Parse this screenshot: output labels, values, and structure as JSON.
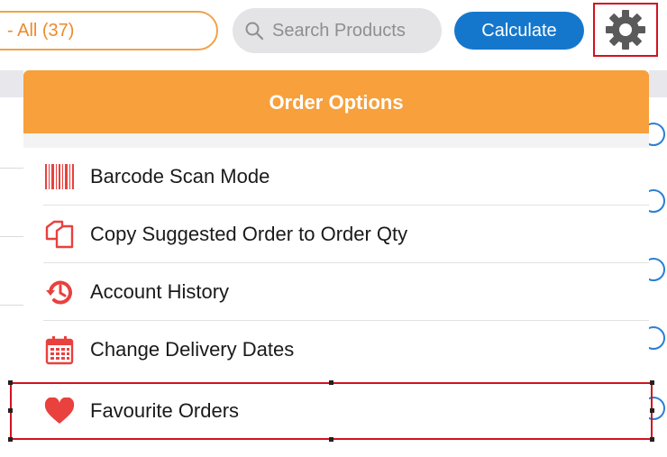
{
  "toolbar": {
    "filter_label": "- All (37)",
    "search_placeholder": "Search Products",
    "calculate_label": "Calculate"
  },
  "popover": {
    "title": "Order Options",
    "items": [
      {
        "label": "Barcode Scan Mode",
        "icon": "barcode-icon"
      },
      {
        "label": "Copy Suggested Order to Order Qty",
        "icon": "copy-icon"
      },
      {
        "label": "Account History",
        "icon": "history-icon"
      },
      {
        "label": "Change Delivery Dates",
        "icon": "calendar-icon"
      },
      {
        "label": "Favourite Orders",
        "icon": "heart-icon"
      }
    ]
  },
  "colors": {
    "accent_orange": "#f7a03c",
    "primary_blue": "#1577cc",
    "icon_red": "#e8413e",
    "highlight_red": "#d2121f"
  }
}
